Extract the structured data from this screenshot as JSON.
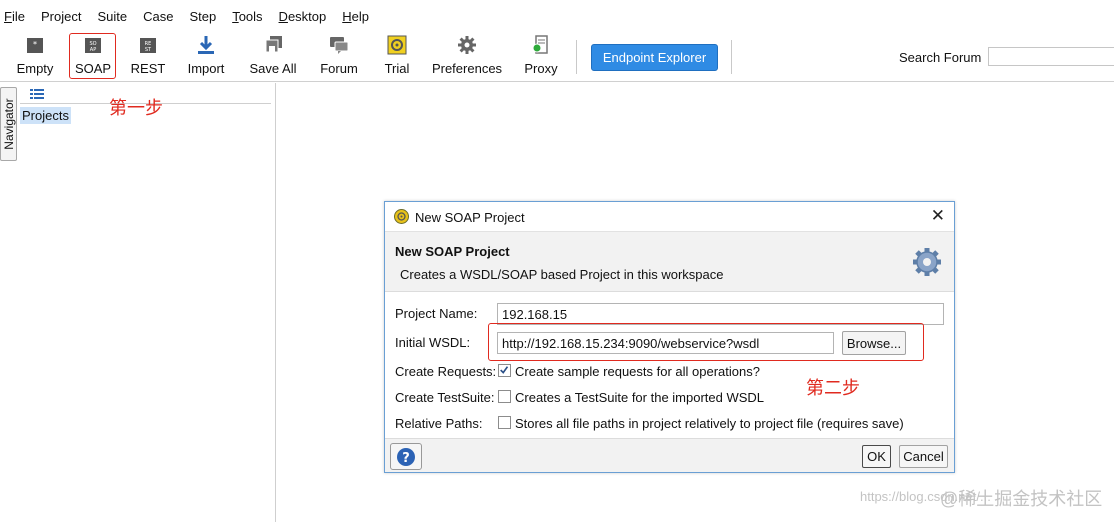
{
  "menu": [
    {
      "label": "File",
      "mnemonic": "F",
      "rest": "ile"
    },
    {
      "label": "Project",
      "mnemonic": "",
      "rest": "Project"
    },
    {
      "label": "Suite",
      "mnemonic": "",
      "rest": "Suite"
    },
    {
      "label": "Case",
      "mnemonic": "",
      "rest": "Case"
    },
    {
      "label": "Step",
      "mnemonic": "",
      "rest": "Step"
    },
    {
      "label": "Tools",
      "mnemonic": "T",
      "rest": "ools"
    },
    {
      "label": "Desktop",
      "mnemonic": "D",
      "rest": "esktop"
    },
    {
      "label": "Help",
      "mnemonic": "H",
      "rest": "elp"
    }
  ],
  "toolbar": {
    "empty": "Empty",
    "soap": "SOAP",
    "rest": "REST",
    "import": "Import",
    "save_all": "Save All",
    "forum": "Forum",
    "trial": "Trial",
    "preferences": "Preferences",
    "proxy": "Proxy",
    "endpoint_explorer": "Endpoint Explorer",
    "search_forum_label": "Search Forum",
    "search_forum_value": ""
  },
  "navigator": {
    "tab_label": "Navigator",
    "root_node": "Projects"
  },
  "annotations": {
    "step1": "第一步",
    "step2": "第二步"
  },
  "dialog": {
    "window_title": "New SOAP Project",
    "header_title": "New SOAP Project",
    "header_subtitle": "Creates a WSDL/SOAP based Project in this workspace",
    "project_name_label": "Project Name:",
    "project_name_value": "192.168.15",
    "initial_wsdl_label": "Initial WSDL:",
    "initial_wsdl_value": "http://192.168.15.234:9090/webservice?wsdl",
    "browse": "Browse...",
    "create_requests_label": "Create Requests:",
    "create_requests_text": "Create sample requests for all operations?",
    "create_requests_checked": true,
    "create_testsuite_label": "Create TestSuite:",
    "create_testsuite_text": "Creates a TestSuite for the imported WSDL",
    "create_testsuite_checked": false,
    "relative_paths_label": "Relative Paths:",
    "relative_paths_text": "Stores all file paths in project relatively to project file (requires save)",
    "relative_paths_checked": false,
    "ok": "OK",
    "cancel": "Cancel"
  },
  "watermark": {
    "url": "https://blog.csdn.net/...",
    "brand": "@稀土掘金技术社区"
  },
  "colors": {
    "accent": "#2f8be4",
    "annotation": "#e02a1f",
    "selection": "#cde2f8",
    "dialog_border": "#6a9fd4"
  }
}
